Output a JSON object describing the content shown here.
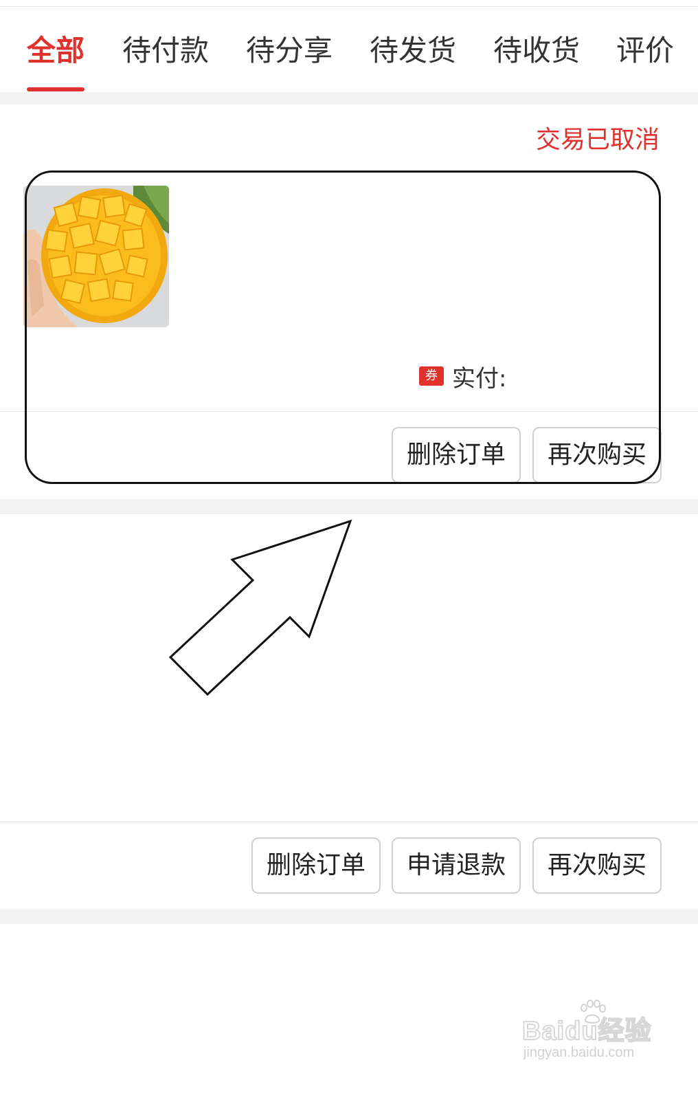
{
  "tabs": [
    {
      "label": "全部",
      "active": true
    },
    {
      "label": "待付款",
      "active": false
    },
    {
      "label": "待分享",
      "active": false
    },
    {
      "label": "待发货",
      "active": false
    },
    {
      "label": "待收货",
      "active": false
    },
    {
      "label": "评价",
      "active": false
    }
  ],
  "order1": {
    "status": "交易已取消",
    "coupon_badge": "券",
    "paid_label": "实付:",
    "product_image": "mango-photo",
    "buttons": {
      "delete": "删除订单",
      "rebuy": "再次购买"
    }
  },
  "order2": {
    "buttons": {
      "delete": "删除订单",
      "refund": "申请退款",
      "rebuy": "再次购买"
    }
  },
  "watermark": {
    "main": "Baidu经验",
    "sub": "jingyan.baidu.com"
  },
  "colors": {
    "accent": "#e0322c",
    "separator": "#f2f2f2",
    "border": "#cfcfcf"
  }
}
